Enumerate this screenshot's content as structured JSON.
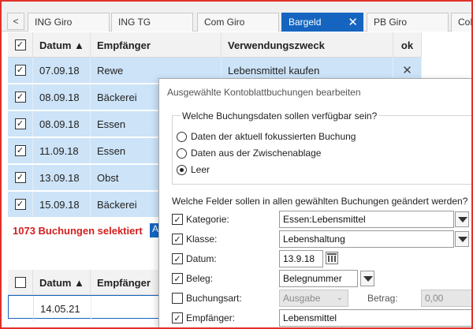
{
  "tabs": [
    {
      "label": "ING Giro",
      "active": false
    },
    {
      "label": "ING TG",
      "active": false
    },
    {
      "label": "Com Giro",
      "active": false
    },
    {
      "label": "Bargeld",
      "active": true
    },
    {
      "label": "PB Giro",
      "active": false
    },
    {
      "label": "CoB",
      "active": false
    }
  ],
  "tab_scroll_glyph": "<",
  "tab_close_glyph": "✕",
  "grid": {
    "headers": {
      "datum": "Datum ▲",
      "empfaenger": "Empfänger",
      "verwendungszweck": "Verwendungszweck",
      "ok": "ok"
    },
    "rows": [
      {
        "datum": "07.09.18",
        "empfaenger": "Rewe",
        "verwendungszweck": "Lebensmittel kaufen",
        "ok": "✕"
      },
      {
        "datum": "08.09.18",
        "empfaenger": "Bäckerei",
        "verwendungszweck": "",
        "ok": ""
      },
      {
        "datum": "08.09.18",
        "empfaenger": "Essen",
        "verwendungszweck": "",
        "ok": ""
      },
      {
        "datum": "11.09.18",
        "empfaenger": "Essen",
        "verwendungszweck": "",
        "ok": ""
      },
      {
        "datum": "13.09.18",
        "empfaenger": "Obst",
        "verwendungszweck": "",
        "ok": ""
      },
      {
        "datum": "15.09.18",
        "empfaenger": "Bäckerei",
        "verwendungszweck": "",
        "ok": ""
      }
    ]
  },
  "summary": {
    "text": "1073 Buchungen selektiert",
    "chip": "A"
  },
  "bottom_grid": {
    "headers": {
      "datum": "Datum ▲",
      "empfaenger": "Empfänger"
    },
    "new_row_datum": "14.05.21"
  },
  "dialog": {
    "title": "Ausgewählte Kontoblattbuchungen bearbeiten",
    "group_legend": "Welche Buchungsdaten sollen verfügbar sein?",
    "options": [
      {
        "label": "Daten der aktuell fokussierten Buchung",
        "selected": false
      },
      {
        "label": "Daten aus der Zwischenablage",
        "selected": false
      },
      {
        "label": "Leer",
        "selected": true
      }
    ],
    "fields_question": "Welche Felder sollen in allen gewählten Buchungen geändert werden?",
    "fields": {
      "kategorie": {
        "label": "Kategorie:",
        "value": "Essen:Lebensmittel",
        "checked": true
      },
      "klasse": {
        "label": "Klasse:",
        "value": "Lebenshaltung",
        "checked": true
      },
      "datum": {
        "label": "Datum:",
        "value": "13.9.18",
        "checked": true
      },
      "beleg": {
        "label": "Beleg:",
        "value": "Belegnummer",
        "checked": true
      },
      "buchungsart": {
        "label": "Buchungsart:",
        "value": "Ausgabe",
        "checked": false
      },
      "betrag": {
        "label": "Betrag:",
        "value": "0,00"
      },
      "empfaenger": {
        "label": "Empfänger:",
        "value": "Lebensmittel",
        "checked": true
      }
    }
  },
  "checkmark_glyph": "✓"
}
